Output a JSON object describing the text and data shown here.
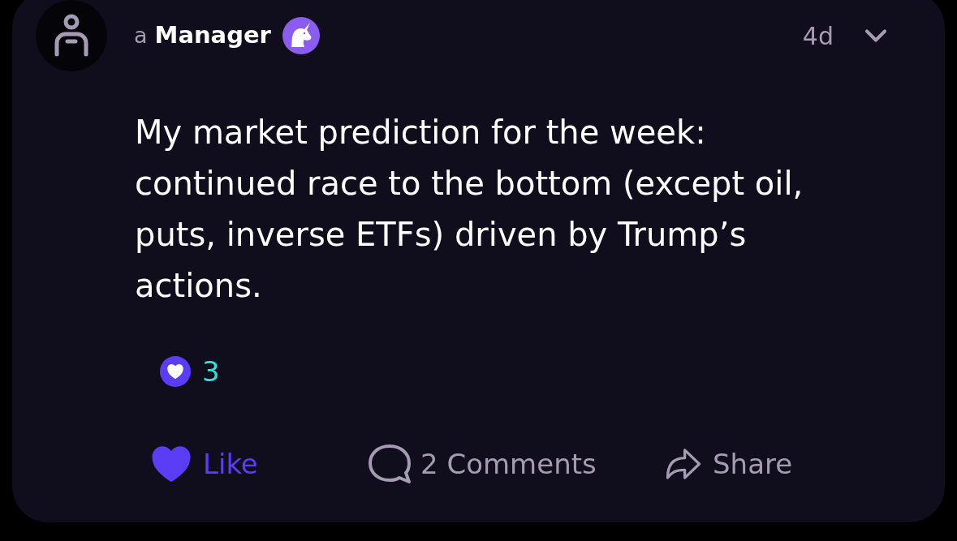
{
  "post": {
    "author": {
      "prefix": "a",
      "name": "Manager",
      "verified": true
    },
    "time": "4d",
    "body": "My market prediction for the week: continued race to the bottom (except oil, puts, inverse ETFs) driven by Trump’s actions.",
    "reactions": [
      {
        "kind": "heart",
        "count": "3"
      }
    ],
    "actions": [
      {
        "kind": "like",
        "label": "Like",
        "active": true
      },
      {
        "kind": "comment",
        "label": "2 Comments",
        "active": false
      },
      {
        "kind": "share",
        "label": "Share",
        "active": false
      }
    ]
  }
}
